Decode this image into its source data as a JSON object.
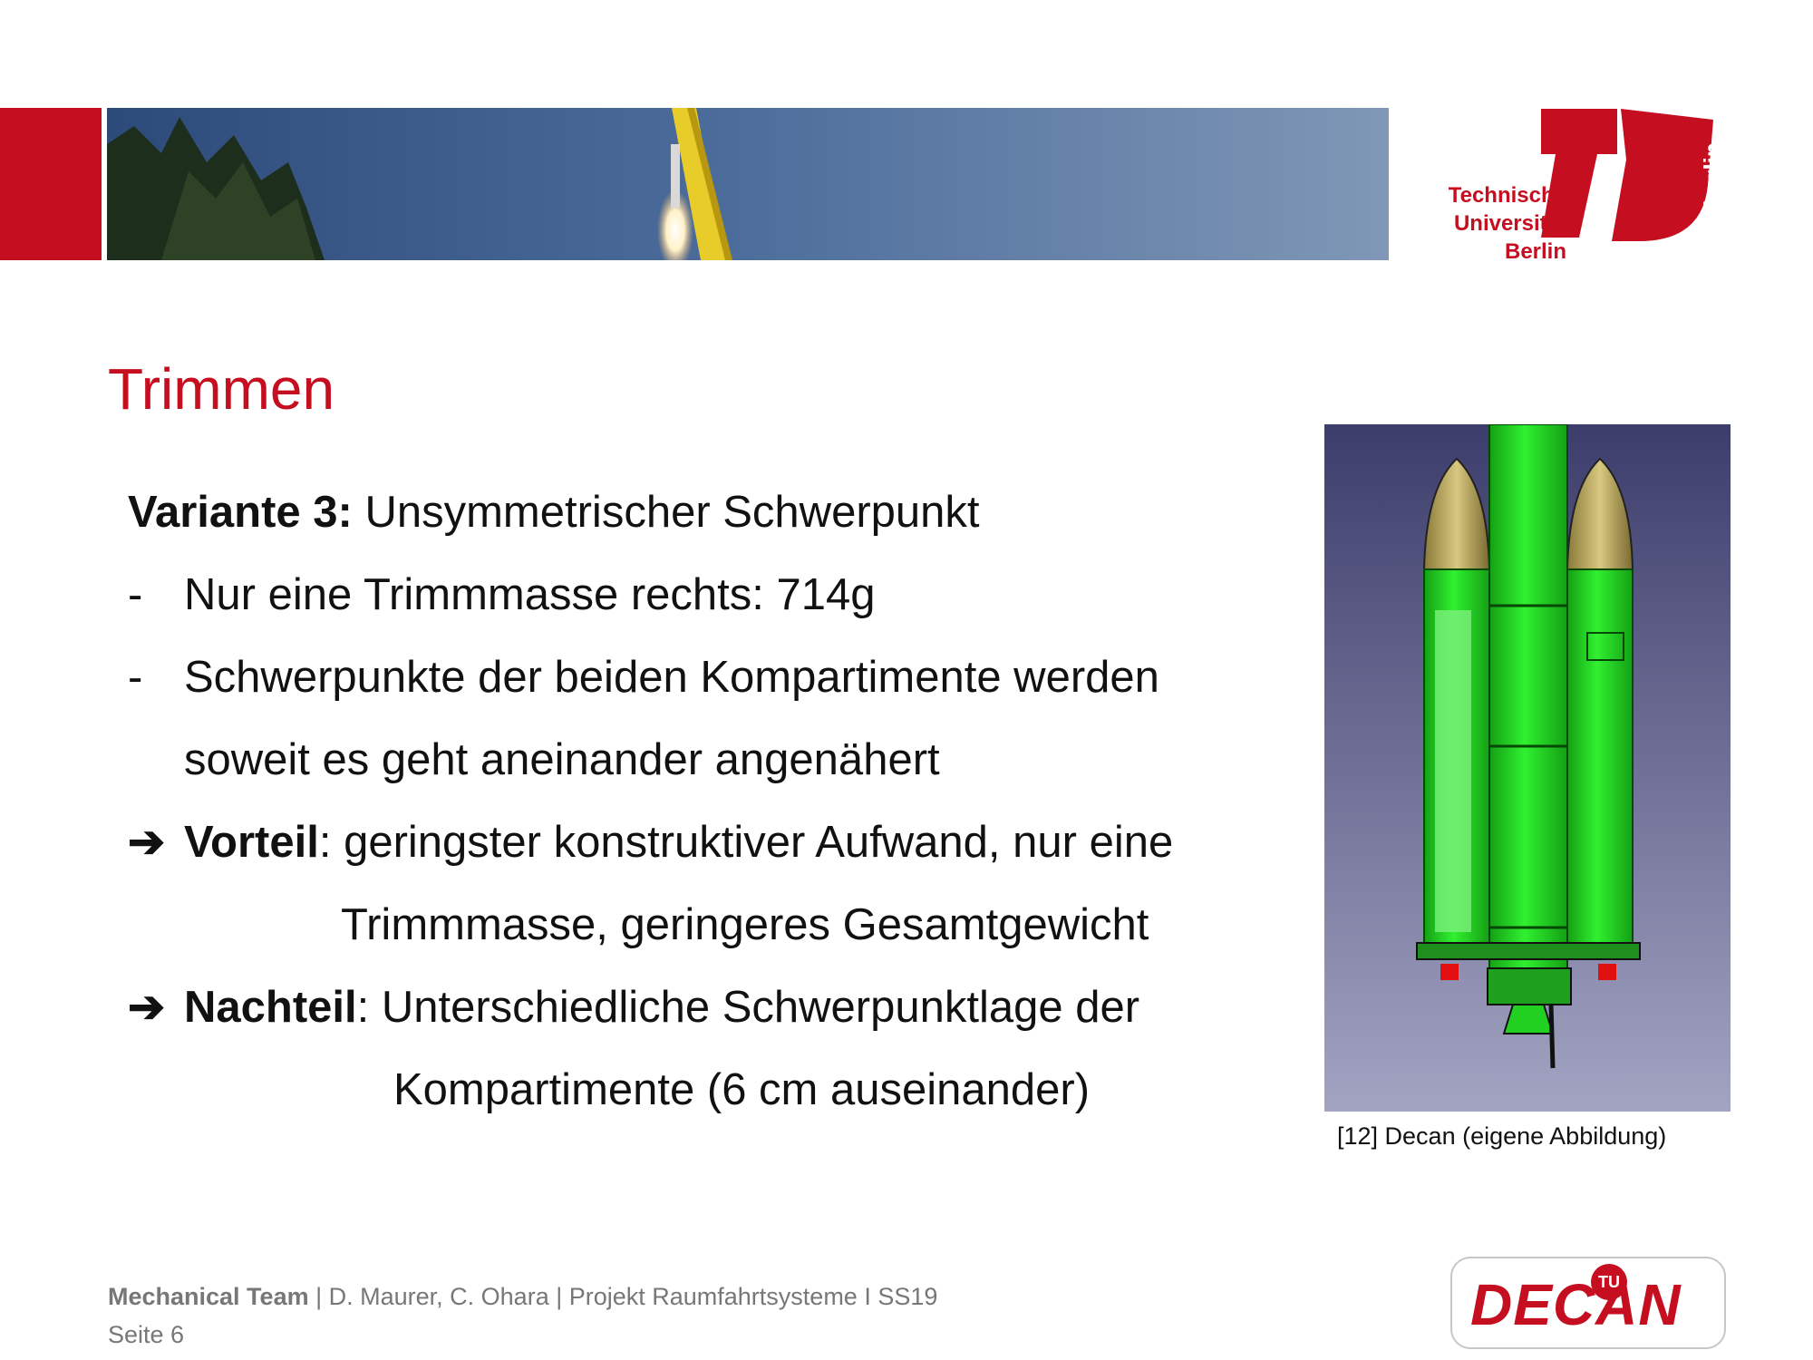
{
  "header": {
    "logo_text": [
      "Technische",
      "Universität",
      "Berlin"
    ],
    "logo_side_text": "berlin"
  },
  "title": "Trimmen",
  "content": {
    "heading_bold": "Variante 3:",
    "heading_rest": " Unsymmetrischer Schwerpunkt",
    "bullet_symbol": "-",
    "bullet1": "Nur eine Trimmmasse rechts:  714g",
    "bullet2_line1": "Schwerpunkte der beiden Kompartimente werden",
    "bullet2_line2": "soweit es geht aneinander angenähert",
    "arrow_symbol": "➔",
    "advantage_label": "Vorteil",
    "advantage_line1": ": geringster konstruktiver Aufwand, nur eine",
    "advantage_line2": "Trimmmasse, geringeres Gesamtgewicht",
    "disadvantage_label": "Nachteil",
    "disadvantage_line1": ": Unterschiedliche Schwerpunktlage der",
    "disadvantage_line2": "Kompartimente (6 cm auseinander)"
  },
  "figure": {
    "caption": "[12] Decan (eigene Abbildung)"
  },
  "footer": {
    "team": "Mechanical Team",
    "separator": " | ",
    "rest": " D. Maurer, C. Ohara | Projekt Raumfahrtsysteme I SS19",
    "page": "Seite 6"
  },
  "decan_logo": {
    "text": "DECAN",
    "badge": "TU"
  },
  "colors": {
    "tu_red": "#c50e1f",
    "rocket_green": "#22e022",
    "figure_bg_top": "#404070",
    "figure_bg_bottom": "#a0a0c0"
  }
}
